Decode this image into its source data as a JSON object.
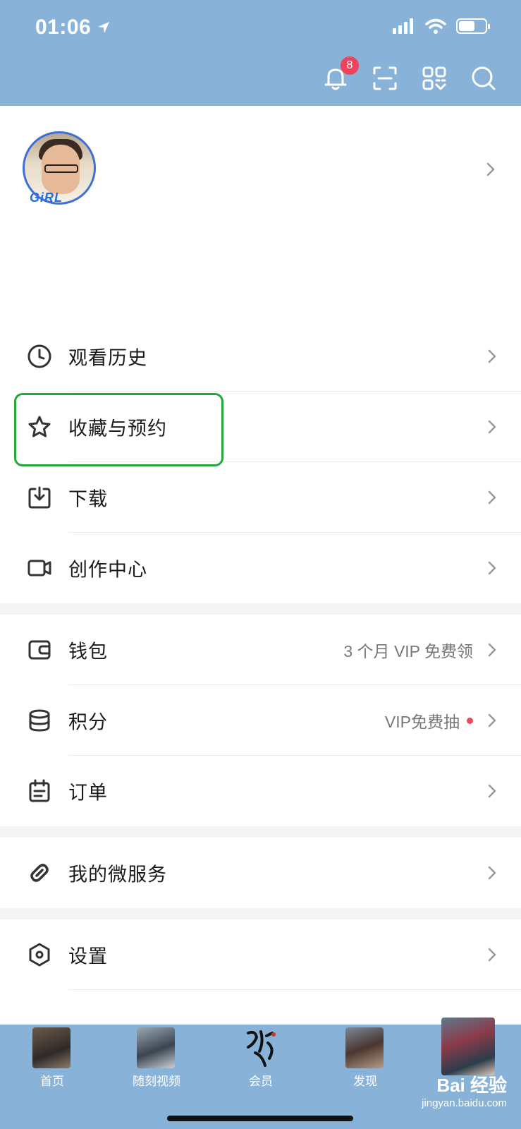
{
  "status_bar": {
    "time": "01:06"
  },
  "header": {
    "notification_count": "8"
  },
  "profile": {
    "avatar_tag": "GiRL"
  },
  "menu_group_1": [
    {
      "label": "观看历史",
      "icon": "clock-icon"
    },
    {
      "label": "收藏与预约",
      "icon": "star-icon"
    },
    {
      "label": "下载",
      "icon": "download-icon"
    },
    {
      "label": "创作中心",
      "icon": "camera-icon"
    }
  ],
  "menu_group_2": [
    {
      "label": "钱包",
      "icon": "wallet-icon",
      "hint": "3 个月 VIP 免费领"
    },
    {
      "label": "积分",
      "icon": "coins-icon",
      "hint": "VIP免费抽"
    },
    {
      "label": "订单",
      "icon": "order-icon"
    }
  ],
  "menu_group_3": [
    {
      "label": "我的微服务",
      "icon": "link-icon"
    }
  ],
  "menu_group_4": [
    {
      "label": "设置",
      "icon": "settings-icon"
    }
  ],
  "tabbar": [
    {
      "label": "首页"
    },
    {
      "label": "随刻视频"
    },
    {
      "label": "会员"
    },
    {
      "label": "发现"
    }
  ],
  "watermark": {
    "brand": "Bai 经验",
    "url": "jingyan.baidu.com"
  },
  "colors": {
    "header_bg": "#88b2d8",
    "highlight": "#22a83a",
    "badge": "#f0425a"
  }
}
